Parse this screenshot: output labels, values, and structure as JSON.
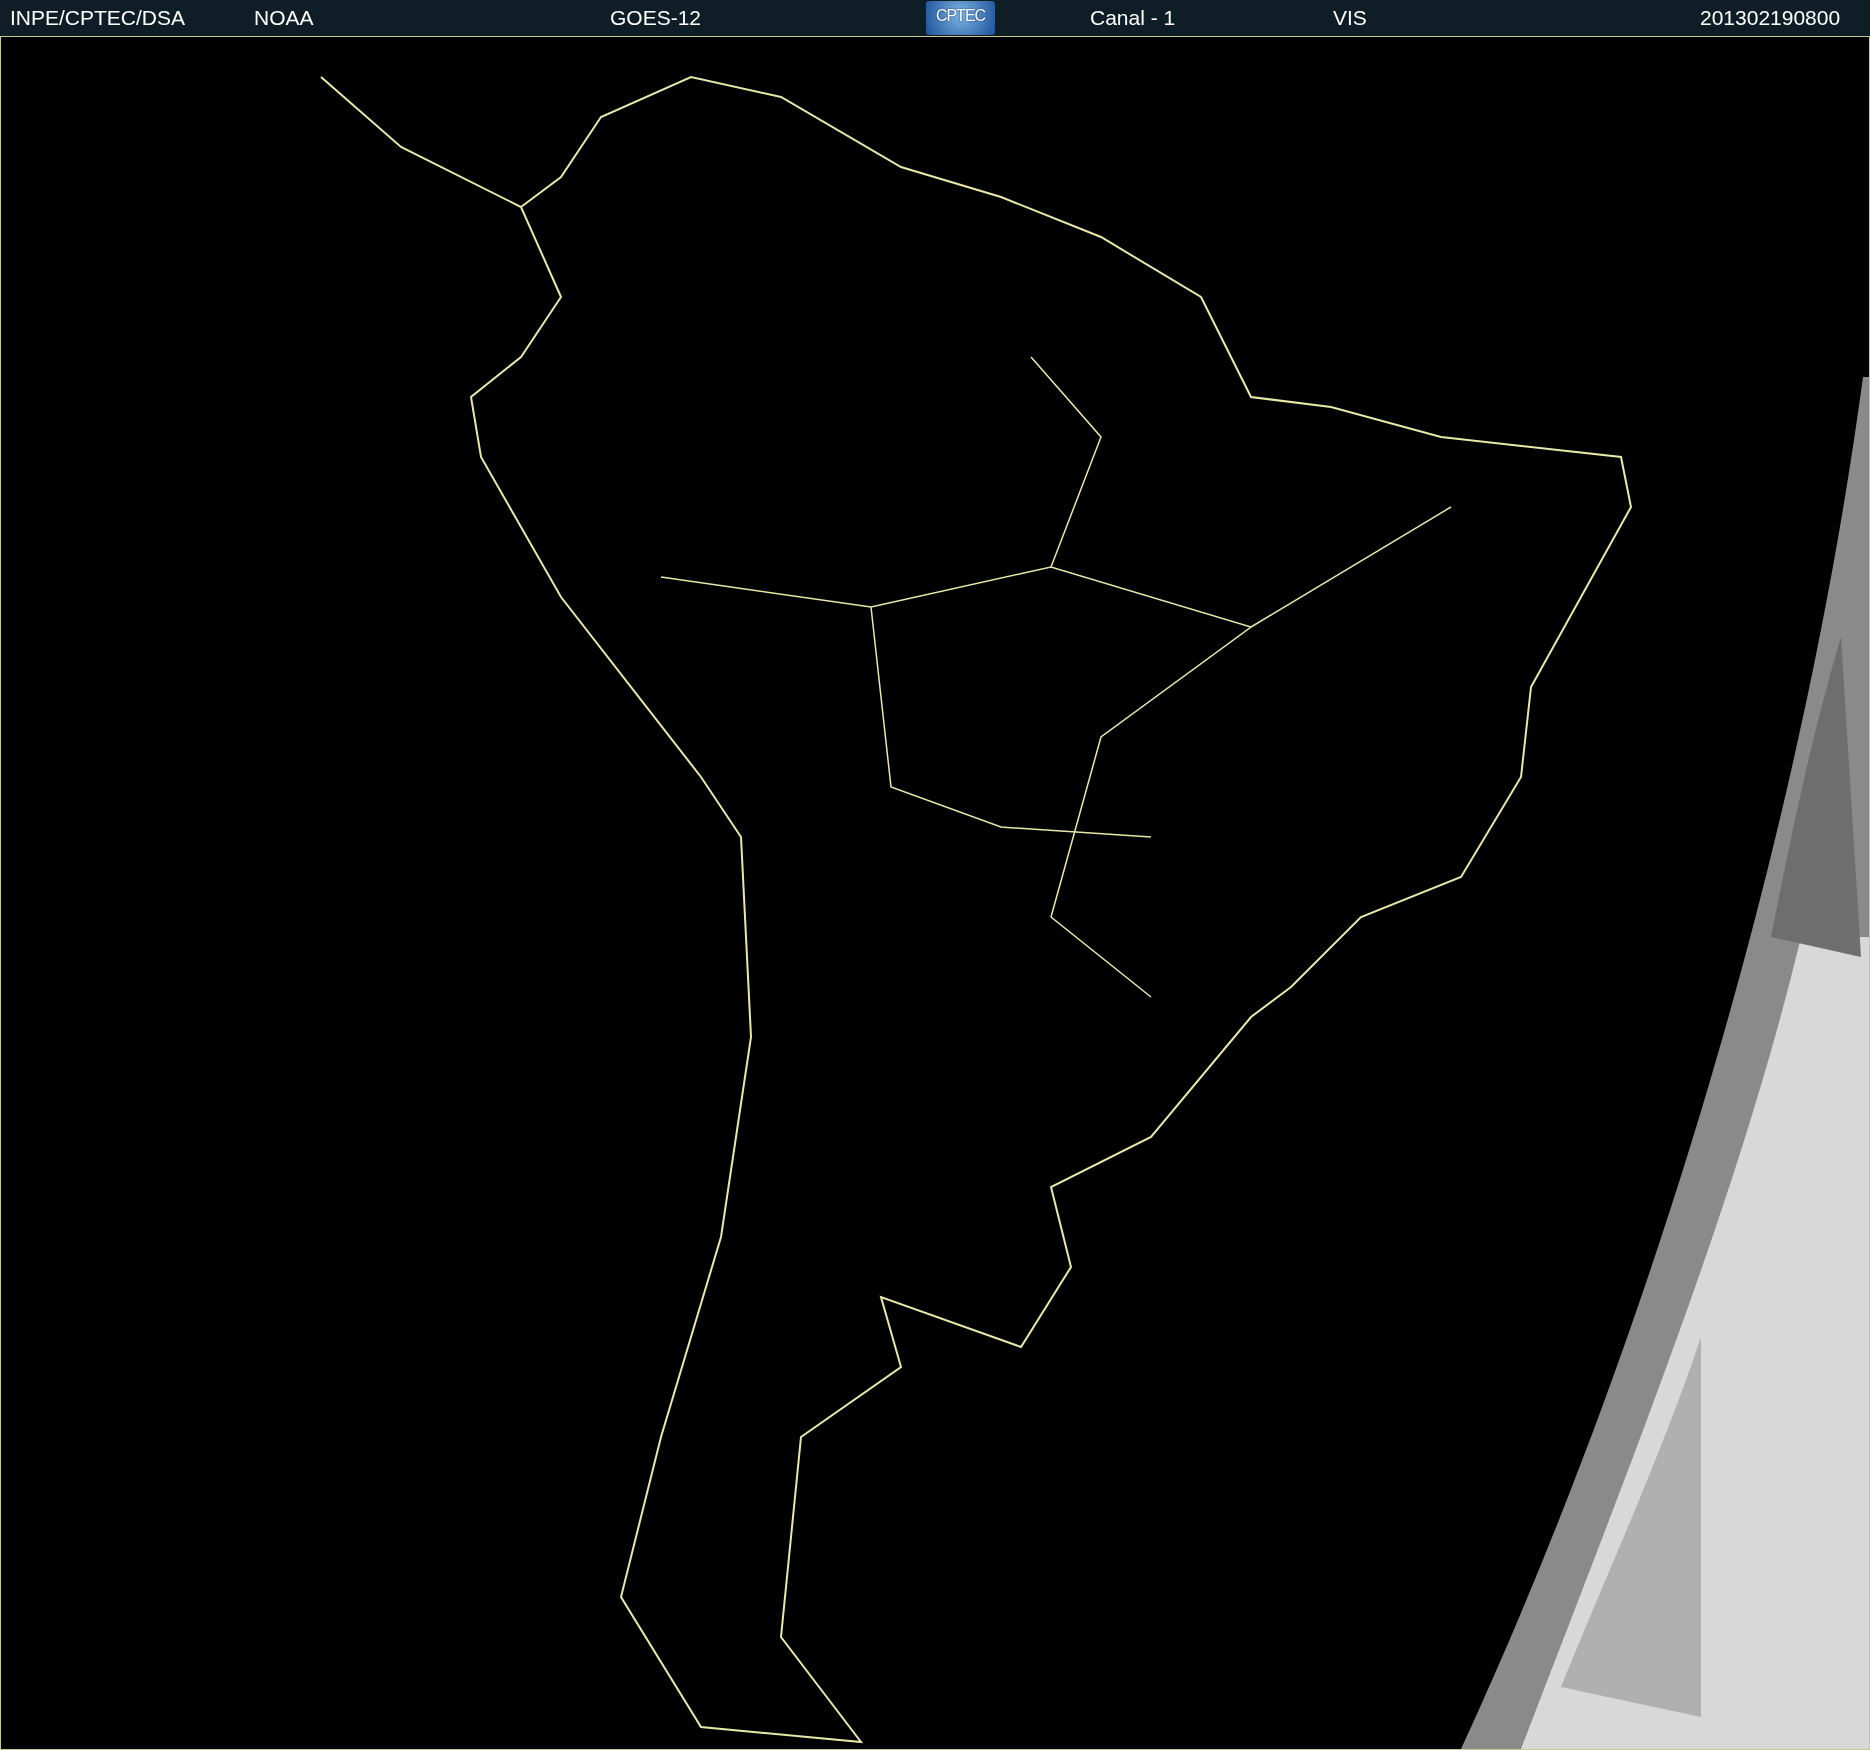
{
  "header": {
    "items": [
      {
        "kind": "text",
        "text": "INPE/CPTEC/DSA"
      },
      {
        "kind": "text",
        "text": "NOAA"
      },
      {
        "kind": "text",
        "text": "GOES-12"
      },
      {
        "kind": "logo",
        "text": "CPTEC"
      },
      {
        "kind": "text",
        "text": "Canal - 1"
      },
      {
        "kind": "text",
        "text": "VIS"
      },
      {
        "kind": "text",
        "text": "201302190800"
      }
    ]
  }
}
